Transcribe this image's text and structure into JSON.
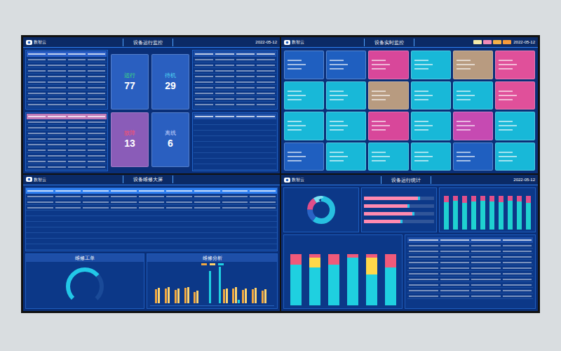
{
  "screen": {
    "status_panel": {
      "logo": "数智云",
      "title": "设备运行监控",
      "date": "2022-05-12",
      "tiles": [
        {
          "label": "运行",
          "count": "77",
          "color": "#2a5fc0",
          "label_color": "#3ee07a"
        },
        {
          "label": "待机",
          "count": "29",
          "color": "#2a5fc0",
          "label_color": "#4fd6f0"
        },
        {
          "label": "故障",
          "count": "13",
          "color": "#8a5cb8",
          "label_color": "#ff4f6a"
        },
        {
          "label": "离线",
          "count": "6",
          "color": "#2a5fc0",
          "label_color": "#c9d6ff"
        }
      ]
    },
    "realtime_panel": {
      "logo": "数智云",
      "title": "设备实时监控",
      "date": "2022-05-12",
      "legend": [
        {
          "color": "#f3e9a8"
        },
        {
          "color": "#f08ab8"
        },
        {
          "color": "#f5b048"
        },
        {
          "color": "#f59a3a"
        }
      ],
      "cards": [
        {
          "color": "#1f5fc0"
        },
        {
          "color": "#1f5fc0"
        },
        {
          "color": "#d8479a"
        },
        {
          "color": "#18b8d8"
        },
        {
          "color": "#b89b80"
        },
        {
          "color": "#e0509a"
        },
        {
          "color": "#18b8d8"
        },
        {
          "color": "#18b8d8"
        },
        {
          "color": "#b89b80"
        },
        {
          "color": "#18b8d8"
        },
        {
          "color": "#18b8d8"
        },
        {
          "color": "#e0509a"
        },
        {
          "color": "#18b8d8"
        },
        {
          "color": "#18b8d8"
        },
        {
          "color": "#d8479a"
        },
        {
          "color": "#18b8d8"
        },
        {
          "color": "#c64ab2"
        },
        {
          "color": "#18b8d8"
        },
        {
          "color": "#1f5fc0"
        },
        {
          "color": "#18b8d8"
        },
        {
          "color": "#18b8d8"
        },
        {
          "color": "#18b8d8"
        },
        {
          "color": "#1f5fc0"
        },
        {
          "color": "#18b8d8"
        }
      ]
    },
    "repair_panel": {
      "logo": "数智云",
      "title": "设备维修大屏",
      "work_orders": {
        "title": "维修工单",
        "level": 0.68
      },
      "analysis": {
        "title": "维修分析",
        "series": [
          {
            "color": "#f0a640",
            "values": [
              38,
              40,
              36,
              42,
              30,
              0,
              0,
              38,
              40,
              36,
              38,
              34
            ]
          },
          {
            "color": "#ffd36b",
            "values": [
              42,
              44,
              40,
              45,
              34,
              0,
              0,
              40,
              44,
              40,
              42,
              38
            ]
          },
          {
            "color": "#1fd0e0",
            "values": [
              0,
              0,
              0,
              0,
              0,
              88,
              100,
              0,
              10,
              0,
              0,
              0
            ]
          }
        ]
      }
    },
    "stats_panel": {
      "logo": "数智云",
      "title": "设备运行统计",
      "date": "2022-05-12",
      "donut": {
        "segments": [
          {
            "value": 60,
            "color": "#27c0e0"
          },
          {
            "value": 15,
            "color": "#2a63c4"
          },
          {
            "value": 15,
            "color": "#e04f8a"
          },
          {
            "value": 10,
            "color": "#7de0f0"
          }
        ]
      },
      "hbars": [
        {
          "level": 0.8
        },
        {
          "level": 0.65
        },
        {
          "level": 0.72
        },
        {
          "level": 0.55
        }
      ],
      "stacked_pct": {
        "series": [
          {
            "color": "#1fd0d0",
            "values": [
              82,
              85,
              80,
              83,
              86,
              84,
              81,
              85,
              83,
              80
            ]
          },
          {
            "color": "#e04f8a",
            "values": [
              18,
              15,
              20,
              17,
              14,
              16,
              19,
              15,
              17,
              20
            ]
          }
        ]
      },
      "stacked": {
        "series": [
          {
            "color": "#1fd0e0",
            "values": [
              60,
              55,
              60,
              70,
              45,
              55
            ]
          },
          {
            "color": "#ffd84a",
            "values": [
              0,
              15,
              0,
              0,
              25,
              0
            ]
          },
          {
            "color": "#f05a7a",
            "values": [
              15,
              5,
              15,
              5,
              5,
              20
            ]
          }
        ]
      }
    }
  }
}
